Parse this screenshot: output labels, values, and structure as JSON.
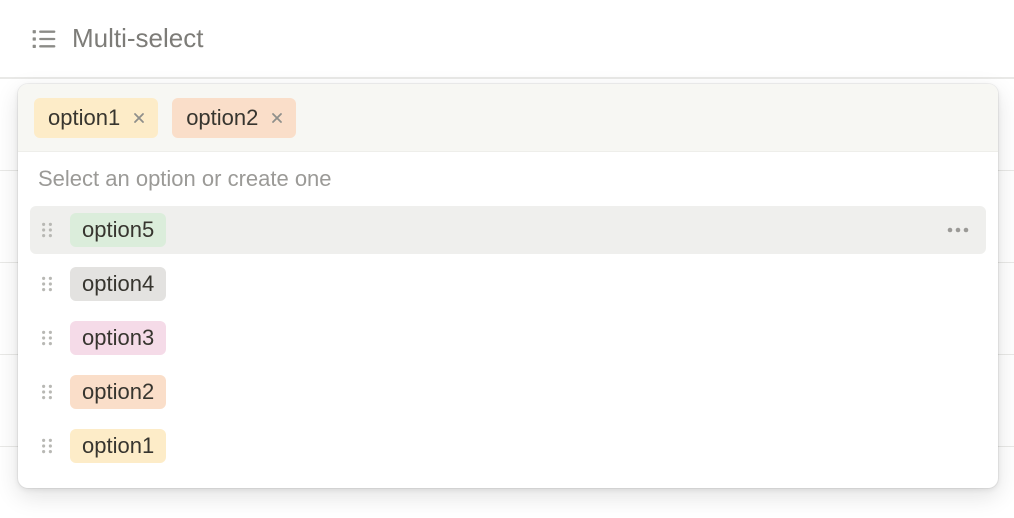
{
  "header": {
    "title": "Multi-select"
  },
  "selected": [
    {
      "label": "option1",
      "colorClass": "c-yellow"
    },
    {
      "label": "option2",
      "colorClass": "c-orange"
    }
  ],
  "helper_text": "Select an option or create one",
  "options": [
    {
      "label": "option5",
      "colorClass": "c-green",
      "highlighted": true
    },
    {
      "label": "option4",
      "colorClass": "c-gray",
      "highlighted": false
    },
    {
      "label": "option3",
      "colorClass": "c-pink",
      "highlighted": false
    },
    {
      "label": "option2",
      "colorClass": "c-orange",
      "highlighted": false
    },
    {
      "label": "option1",
      "colorClass": "c-yellow",
      "highlighted": false
    }
  ]
}
